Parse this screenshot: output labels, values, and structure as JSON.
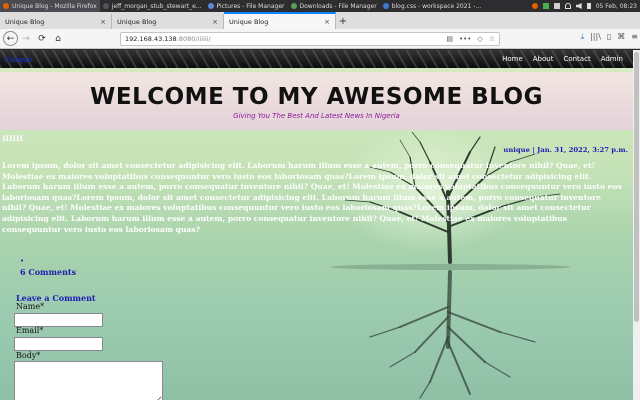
{
  "taskbar": {
    "items": [
      {
        "label": "Unique Blog - Mozilla Firefox",
        "color": "#e66000"
      },
      {
        "label": "jeff_morgan_stub_stewart_e...",
        "color": "#444444"
      },
      {
        "label": "Pictures - File Manager",
        "color": "#5a8ad8"
      },
      {
        "label": "Downloads - File Manager",
        "color": "#5aa05a"
      },
      {
        "label": "blog.css - workspace 2021 -...",
        "color": "#3a7bd5"
      }
    ],
    "clock": "05 Feb, 08:23"
  },
  "browser": {
    "tabs": [
      {
        "label": "Unique Blog"
      },
      {
        "label": "Unique Blog"
      },
      {
        "label": "Unique Blog"
      }
    ],
    "new_tab": "+",
    "close_glyph": "×",
    "url_host": "192.168.43.138",
    "url_rest": ":8080/iiiiii/",
    "icons": {
      "back": "←",
      "forward": "→",
      "reload": "⟳",
      "home": "⌂",
      "reader": "▤",
      "more": "•••",
      "pocket": "◇",
      "star": "☆",
      "download": "⤓",
      "library": "|||\\",
      "sidebar": "▯",
      "extension": "⌘",
      "menu": "≡"
    }
  },
  "site": {
    "logo": "Unique",
    "nav": [
      "Home",
      "About",
      "Contact",
      "Admin"
    ],
    "title": "WELCOME TO MY AWESOME BLOG",
    "tagline": "Giving You The Best And Latest News In Nigeria"
  },
  "post": {
    "title": "IIIIII",
    "meta": "unique | Jan. 31, 2022, 3:27 p.m.",
    "body": "Lorem ipsum, dolor sit amet consectetur adipisicing elit. Laborum harum illum esse a autem, porro consequatur inventore nihil? Quae, et! Molestiae ex maiores voluptatibus consequuntur vero iusto eos laboriosam quas?Lorem ipsum, dolor sit amet consectetur adipisicing elit. Laborum harum illum esse a autem, porro consequatur inventore nihil? Quae, et! Molestiae ex maiores voluptatibus consequuntur vero iusto eos laboriosam quas?Lorem ipsum, dolor sit amet consectetur adipisicing elit. Laborum harum illum esse a autem, porro consequatur inventore nihil? Quae, et! Molestiae ex maiores voluptatibus consequuntur vero iusto eos laboriosam quas?Lorem ipsum, dolor sit amet consectetur adipisicing elit. Laborum harum illum esse a autem, porro consequatur inventore nihil? Quae, et! Molestiae ex maiores voluptatibus consequuntur vero iusto eos laboriosam quas?",
    "comments_bullet": "•",
    "comments_count": "6 Comments"
  },
  "comment_form": {
    "heading": "Leave a Comment",
    "name_label": "Name*",
    "email_label": "Email*",
    "body_label": "Body*",
    "name_value": "",
    "email_value": "",
    "body_value": ""
  }
}
